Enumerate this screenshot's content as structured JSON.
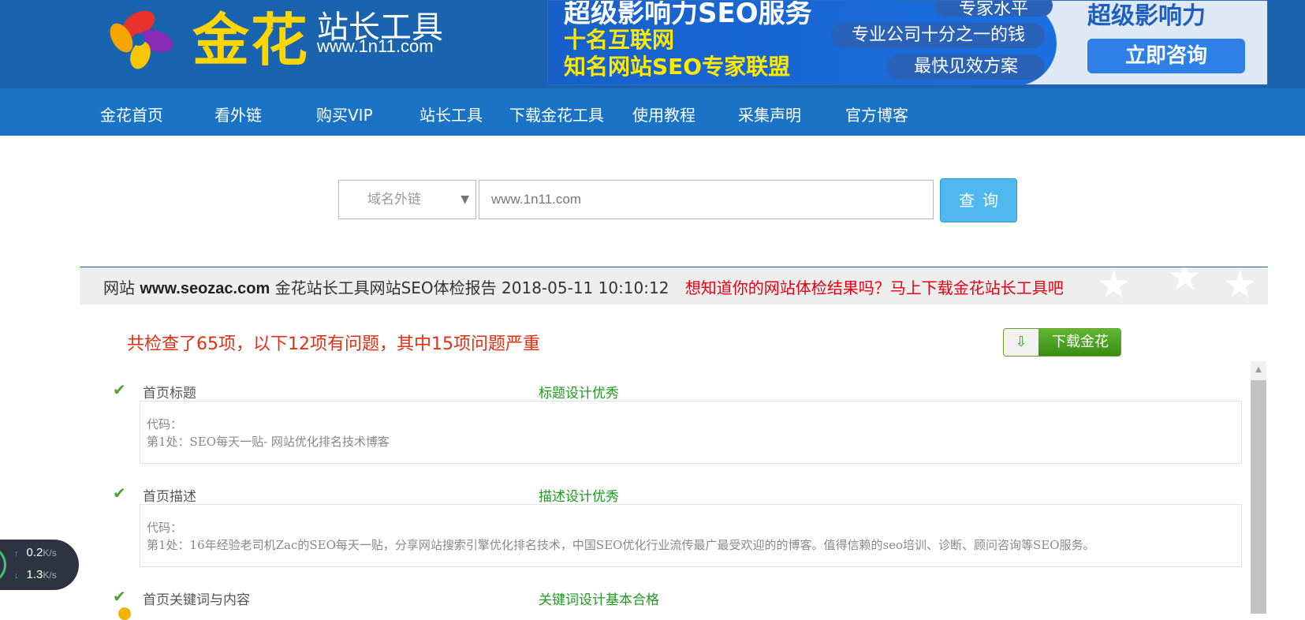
{
  "header": {
    "logo_main": "金花",
    "logo_sub": "站长工具",
    "logo_url": "www.1n11.com"
  },
  "ad": {
    "line1": "超级影响力SEO服务",
    "line2": "十名互联网",
    "line3": "知名网站SEO专家联盟",
    "pill1": "专家水平",
    "pill2": "专业公司十分之一的钱",
    "pill3": "最快见效方案",
    "brand": "超级影响力",
    "cta": "立即咨询"
  },
  "nav": {
    "items": [
      "金花首页",
      "看外链",
      "购买VIP",
      "站长工具",
      "下载金花工具",
      "使用教程",
      "采集声明",
      "官方博客"
    ]
  },
  "search": {
    "select_value": "域名外链",
    "input_value": "www.1n11.com",
    "query_label": "查询"
  },
  "report": {
    "prefix": "网站",
    "site": "www.seozac.com",
    "title": "金花站长工具网站SEO体检报告",
    "datetime": "2018-05-11 10:10:12",
    "promo": "想知道你的网站体检结果吗？马上下载金花站长工具吧"
  },
  "summary": {
    "text": "共检查了65项，以下12项有问题，其中15项问题严重",
    "download_label": "下载金花"
  },
  "items": [
    {
      "name": "首页标题",
      "verdict": "标题设计优秀",
      "code_label": "代码：",
      "code_line": "第1处：SEO每天一贴- 网站优化排名技术博客"
    },
    {
      "name": "首页描述",
      "verdict": "描述设计优秀",
      "code_label": "代码：",
      "code_line": "第1处：16年经验老司机Zac的SEO每天一贴，分享网站搜索引擎优化排名技术，中国SEO优化行业流传最广最受欢迎的的博客。值得信赖的seo培训、诊断、顾问咨询等SEO服务。"
    },
    {
      "name": "首页关键词与内容",
      "verdict": "关键词设计基本合格"
    }
  ],
  "speed_widget": {
    "up_value": "0.2",
    "down_value": "1.3",
    "unit": "K/s"
  },
  "colors": {
    "header_bg": "#1a63ae",
    "nav_bg": "#1a73c4",
    "query_button": "#4fb8ee",
    "alert_red": "#e60012",
    "ok_green": "#1e9a1e"
  }
}
